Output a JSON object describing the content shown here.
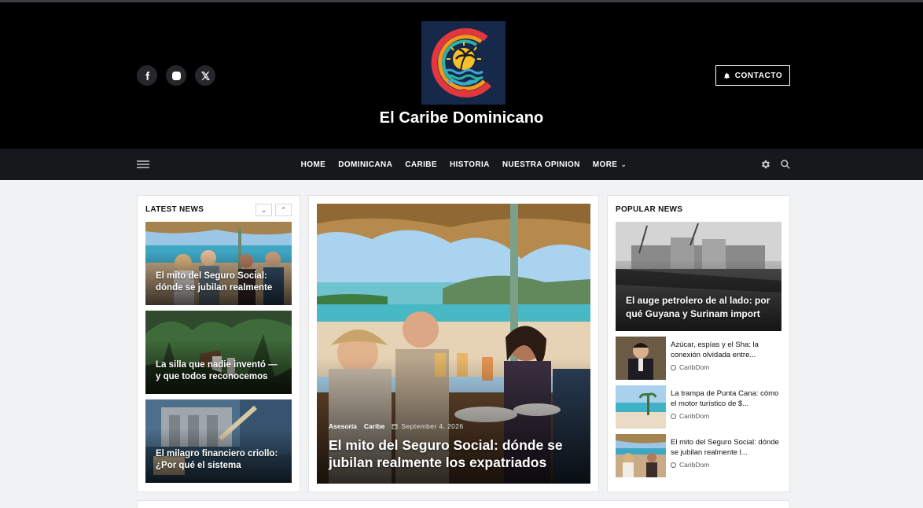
{
  "site": {
    "title": "El Caribe Dominicano",
    "contact_label": "CONTACTO"
  },
  "social": [
    {
      "icon": "facebook-icon"
    },
    {
      "icon": "instagram-icon"
    },
    {
      "icon": "x-icon"
    }
  ],
  "nav": {
    "items": [
      "HOME",
      "DOMINICANA",
      "CARIBE",
      "HISTORIA",
      "NUESTRA OPINION",
      "MORE"
    ],
    "more_chevron": "⌄"
  },
  "latest": {
    "heading": "LATEST NEWS",
    "items": [
      {
        "title": "El mito del Seguro Social: dónde se jubilan realmente"
      },
      {
        "title": "La silla que nadie inventó — y que todos reconocemos"
      },
      {
        "title": "El milagro financiero criollo: ¿Por qué el sistema"
      }
    ]
  },
  "featured": {
    "categories": [
      "Asesoría",
      "Caribe"
    ],
    "date": "September 4, 2026",
    "title": "El mito del Seguro Social: dónde se jubilan realmente los expatriados"
  },
  "popular": {
    "heading": "POPULAR NEWS",
    "lead_title": "El auge petrolero de al lado: por qué Guyana y Surinam import",
    "items": [
      {
        "title": "Azúcar, espías y el Sha: la conexión olvidada entre...",
        "author": "CaribDom"
      },
      {
        "title": "La trampa de Punta Cana: cómo el motor turístico de $...",
        "author": "CaribDom"
      },
      {
        "title": "El mito del Seguro Social: dónde se jubilan realmente l...",
        "author": "CaribDom"
      }
    ]
  },
  "colors": {
    "header_bg": "#000000",
    "nav_bg": "#17181b",
    "page_bg": "#f1f2f4"
  }
}
